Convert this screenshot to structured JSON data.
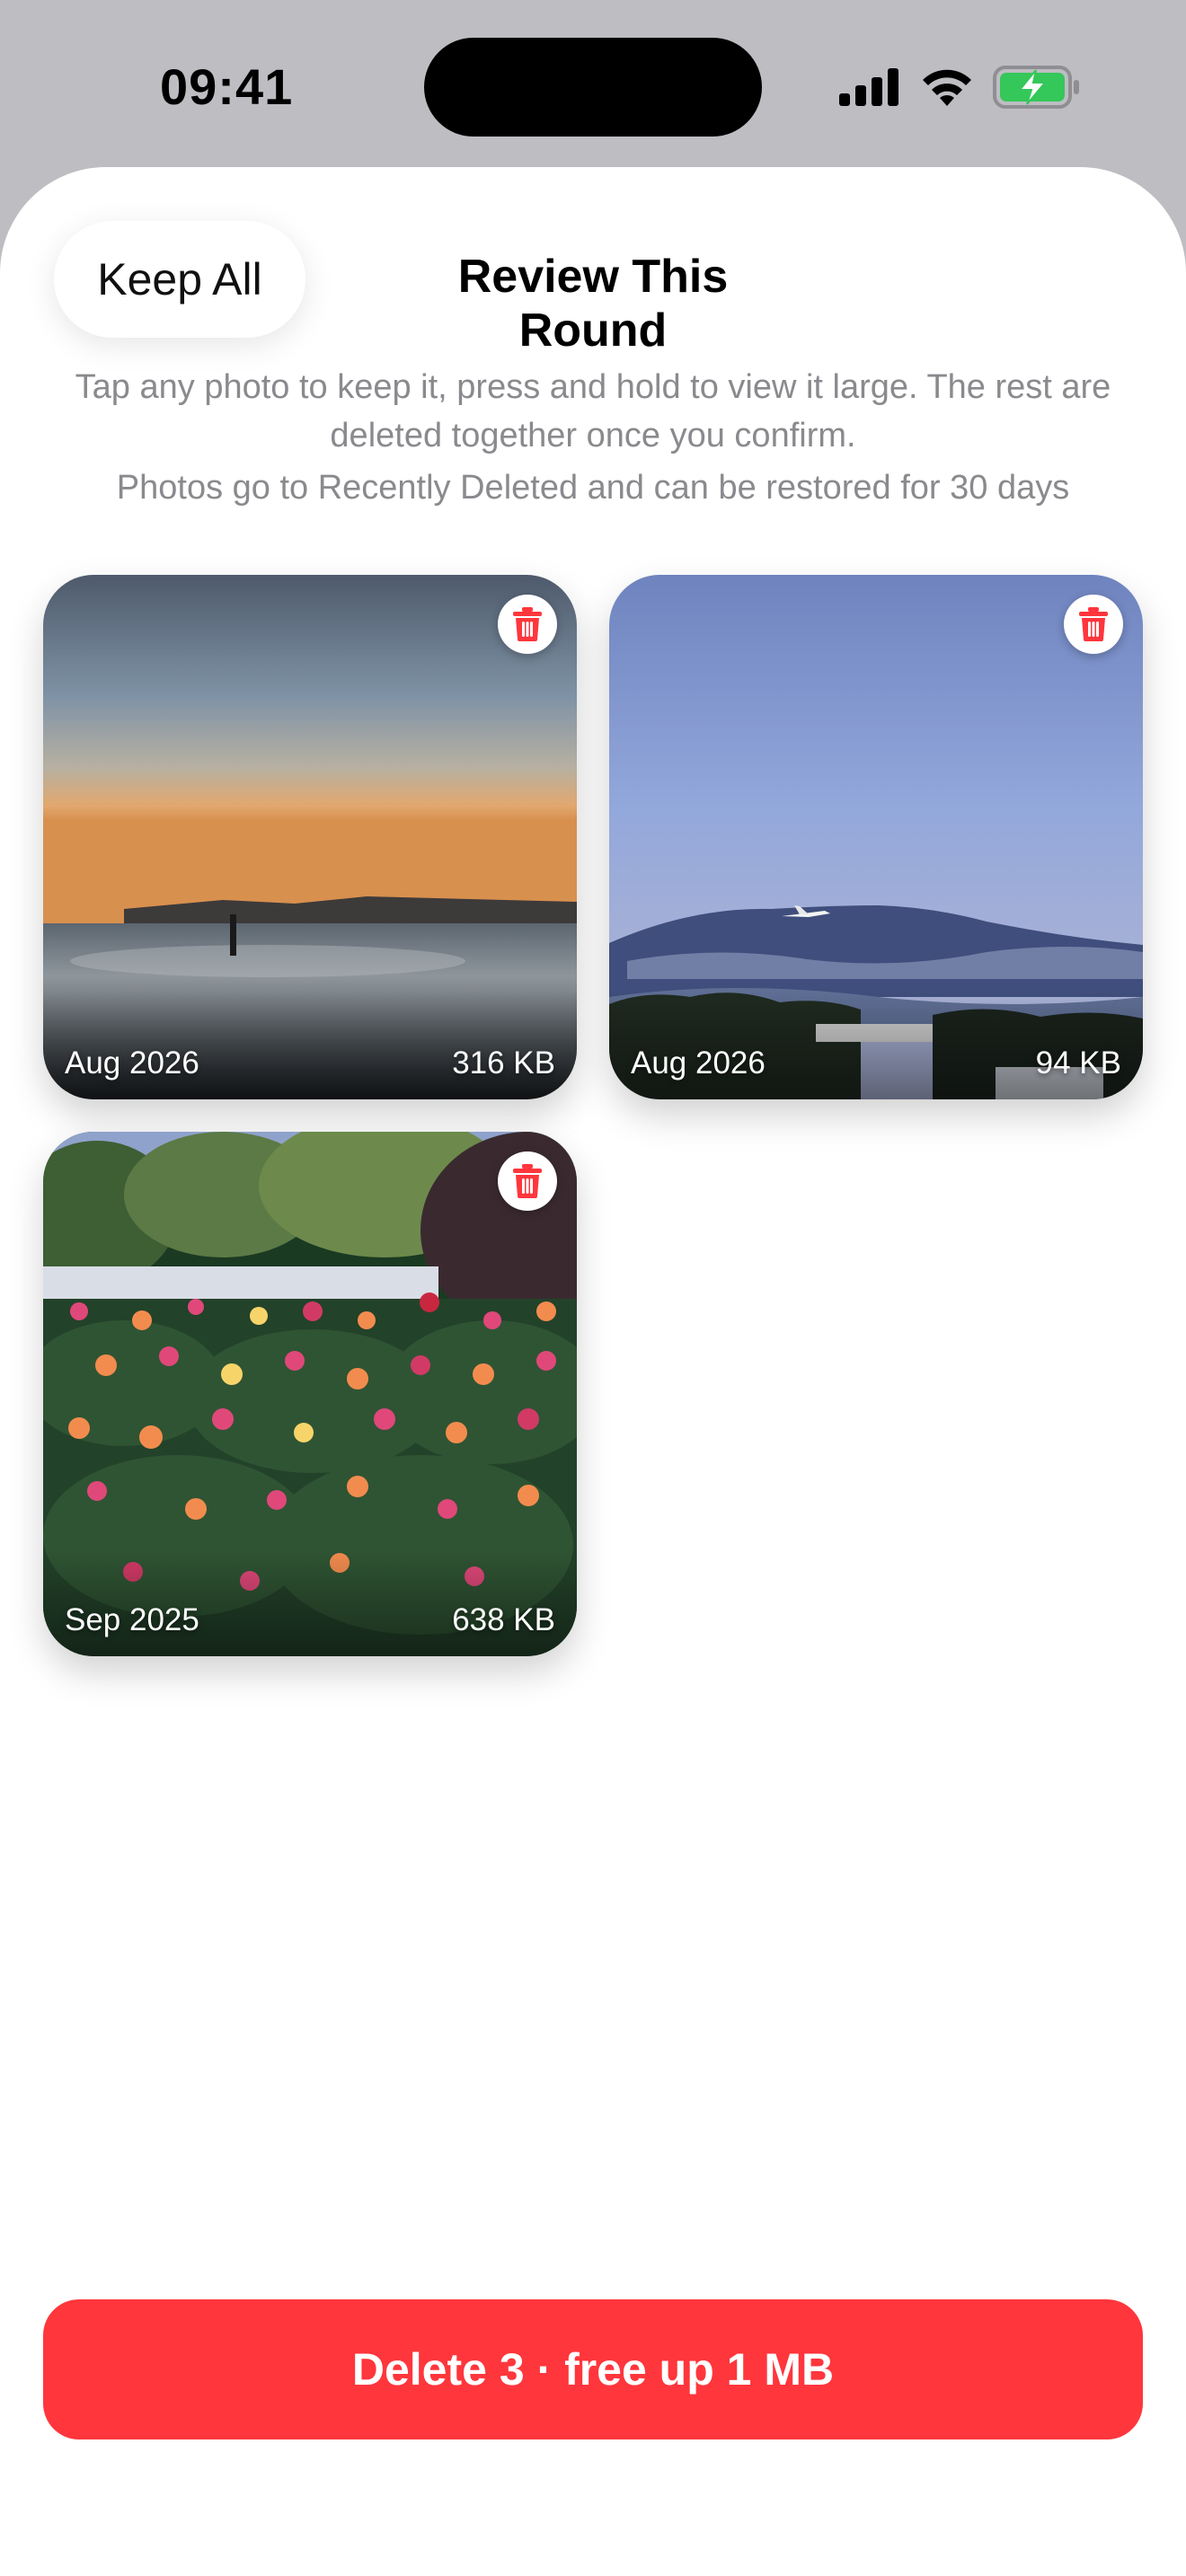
{
  "status_bar": {
    "time": "09:41",
    "icons": [
      "cellular-signal-icon",
      "wifi-icon",
      "battery-charging-icon"
    ],
    "battery_color": "#34C759"
  },
  "sheet": {
    "keep_all_label": "Keep All",
    "title": "Review This Round",
    "instructions": "Tap any photo to keep it, press and hold to view it large. The rest are deleted together once you confirm.",
    "note": "Photos go to Recently Deleted and can be restored for 30 days"
  },
  "photos": [
    {
      "date": "Aug 2026",
      "size": "316 KB",
      "subject": "sunset over sea",
      "action_icon": "trash-icon"
    },
    {
      "date": "Aug 2026",
      "size": "94 KB",
      "subject": "airplane over mountain",
      "action_icon": "trash-icon"
    },
    {
      "date": "Sep 2025",
      "size": "638 KB",
      "subject": "rose garden",
      "action_icon": "trash-icon"
    }
  ],
  "delete_button": {
    "label": "Delete 3 · free up 1 MB",
    "color": "#FF363C"
  }
}
